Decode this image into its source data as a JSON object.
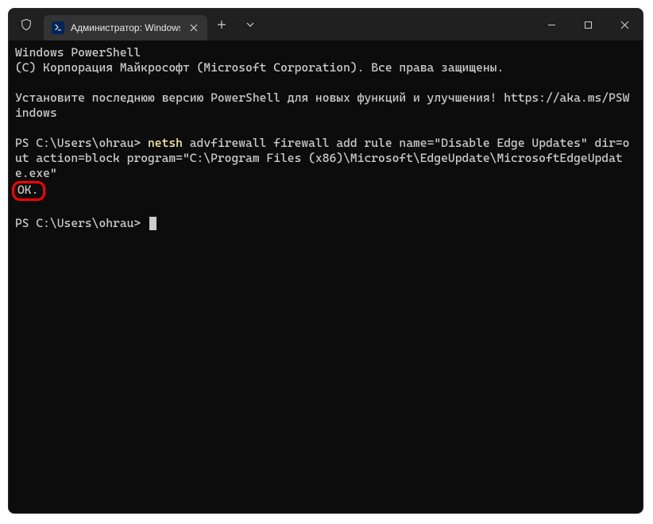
{
  "titlebar": {
    "tab_title": "Администратор: Windows Po"
  },
  "terminal": {
    "line1": "Windows PowerShell",
    "line2": "(С) Корпорация Майкрософт (Microsoft Corporation). Все права защищены.",
    "line3": "Установите последнюю версию PowerShell для новых функций и улучшения! https://aka.ms/PSWindows",
    "prompt1_path": "PS C:\\Users\\ohrau>",
    "cmd_first": "netsh",
    "cmd_rest": " advfirewall firewall add rule name=\"Disable Edge Updates\" dir=out action=block program=\"C:\\Program Files (x86)\\Microsoft\\EdgeUpdate\\MicrosoftEdgeUpdate.exe\"",
    "result": "ОК.",
    "prompt2_path": "PS C:\\Users\\ohrau>"
  }
}
